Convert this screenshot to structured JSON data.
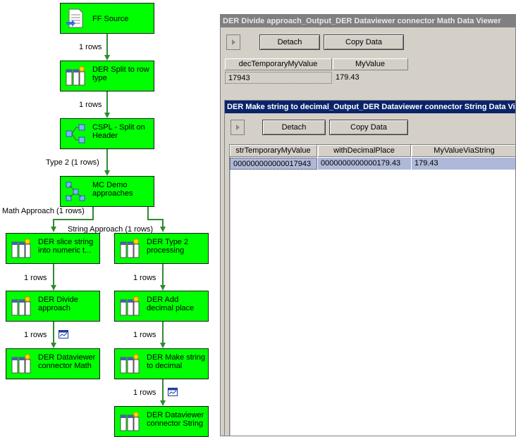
{
  "dataflow": {
    "nodes": {
      "ff_source": "FF Source",
      "split_row_type": "DER Split to row\ntype",
      "cspl_split_header": "CSPL - Split on\nHeader",
      "mc_demo": "MC Demo\napproaches",
      "slice_string": "DER slice string\ninto numeric t...",
      "type2_processing": "DER Type 2\nprocessing",
      "divide_approach": "DER Divide\napproach",
      "add_decimal": "DER Add\ndecimal place",
      "dv_math": "DER Dataviewer\nconnector Math",
      "make_string_decimal": "DER Make string\nto decimal",
      "dv_string": "DER Dataviewer\nconnector String"
    },
    "paths": {
      "p1": "1 rows",
      "p2": "1 rows",
      "p3": "Type 2 (1 rows)",
      "math_approach": "Math Approach (1 rows)",
      "string_approach": "String Approach (1 rows)",
      "p_left1": "1 rows",
      "p_left2": "1 rows",
      "p_right1": "1 rows",
      "p_right2": "1 rows",
      "p_right3": "1 rows"
    }
  },
  "viewer_math": {
    "title": "DER Divide approach_Output_DER Dataviewer connector Math Data Viewer",
    "detach_label": "Detach",
    "copy_label": "Copy Data",
    "columns": [
      "decTemporaryMyValue",
      "MyValue"
    ],
    "rows": [
      [
        "17943",
        "179.43"
      ]
    ]
  },
  "viewer_string": {
    "title": "DER Make string to decimal_Output_DER Dataviewer connector String Data Viewer",
    "detach_label": "Detach",
    "copy_label": "Copy Data",
    "columns": [
      "strTemporaryMyValue",
      "withDecimalPlace",
      "MyValueViaString"
    ],
    "rows": [
      [
        "000000000000017943",
        "0000000000000179.43",
        "179.43"
      ]
    ]
  }
}
